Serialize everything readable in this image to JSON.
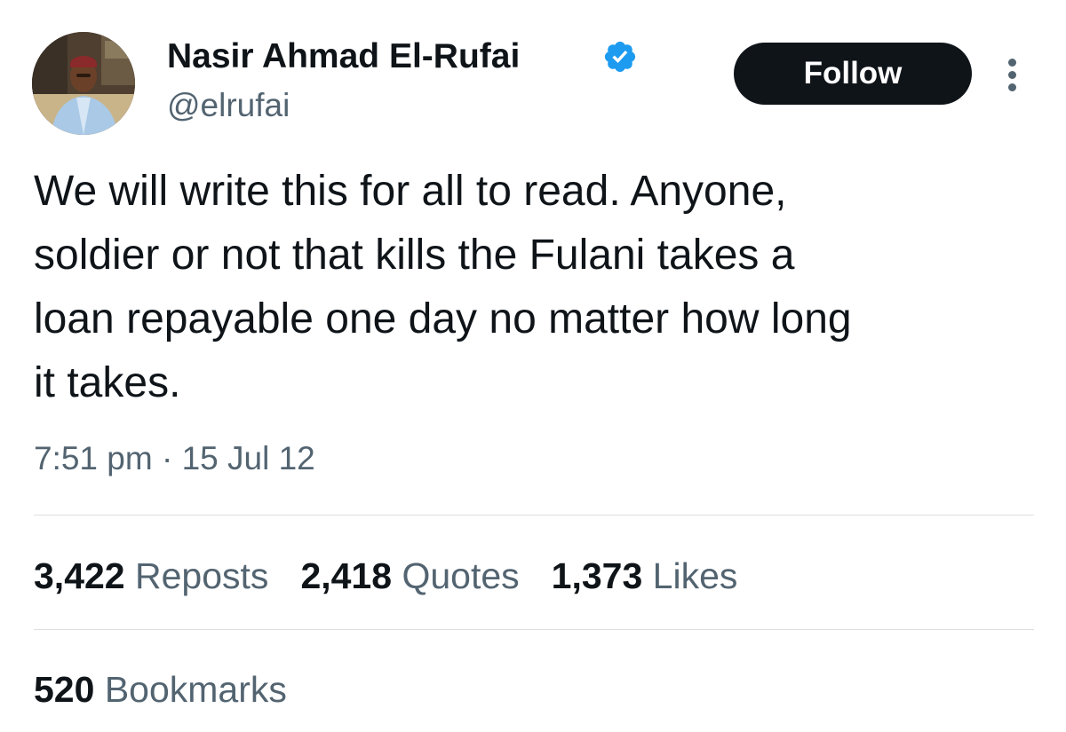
{
  "author": {
    "display_name": "Nasir Ahmad El-Rufai",
    "handle": "@elrufai",
    "verified": true,
    "avatar": "profile-photo"
  },
  "follow_button": {
    "label": "Follow"
  },
  "more_menu": {
    "icon": "more-vertical-icon"
  },
  "tweet": {
    "lines": [
      "We will write this for all to read. Anyone,",
      "soldier or not that kills the Fulani takes a",
      "loan repayable one day no matter how long",
      "it takes."
    ],
    "time": "7:51 pm",
    "separator": "·",
    "date": "15 Jul 12"
  },
  "stats": {
    "reposts": {
      "count": "3,422",
      "label": "Reposts"
    },
    "quotes": {
      "count": "2,418",
      "label": "Quotes"
    },
    "likes": {
      "count": "1,373",
      "label": "Likes"
    },
    "bookmarks": {
      "count": "520",
      "label": "Bookmarks"
    }
  },
  "colors": {
    "text_primary": "#0f1419",
    "text_secondary": "#536471",
    "verified_blue": "#1d9bf0",
    "button_bg": "#0f1419",
    "divider": "#dcdfe2"
  }
}
